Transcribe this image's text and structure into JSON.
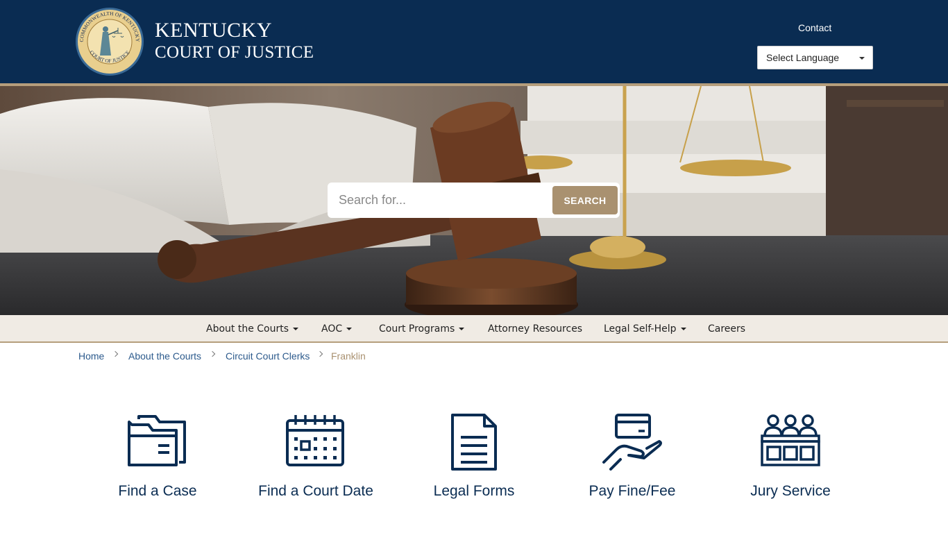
{
  "header": {
    "seal_text_top": "COMMONWEALTH OF KENTUCKY",
    "seal_text_bottom": "COURT OF JUSTICE",
    "brand_line1": "KENTUCKY",
    "brand_line2": "COURT OF JUSTICE",
    "contact_label": "Contact",
    "language_select": "Select Language"
  },
  "search": {
    "placeholder": "Search for...",
    "button_label": "SEARCH"
  },
  "nav": {
    "items": [
      {
        "label": "About the Courts",
        "dropdown": true
      },
      {
        "label": "AOC",
        "dropdown": true
      },
      {
        "label": "Court Programs",
        "dropdown": true
      },
      {
        "label": "Attorney Resources",
        "dropdown": false
      },
      {
        "label": "Legal Self-Help",
        "dropdown": true
      },
      {
        "label": "Careers",
        "dropdown": false
      }
    ]
  },
  "breadcrumb": [
    "Home",
    "About the Courts",
    "Circuit Court Clerks",
    "Franklin"
  ],
  "quick_links": [
    {
      "label": "Find a Case",
      "icon": "folder-icon"
    },
    {
      "label": "Find a Court Date",
      "icon": "calendar-icon"
    },
    {
      "label": "Legal Forms",
      "icon": "document-icon"
    },
    {
      "label": "Pay Fine/Fee",
      "icon": "card-hand-icon"
    },
    {
      "label": "Jury Service",
      "icon": "jury-box-icon"
    }
  ],
  "colors": {
    "navy": "#0a2c52",
    "gold": "#b59e7c",
    "search_button": "#a99170",
    "nav_bg": "#f0ebe4",
    "link": "#2c5a8c"
  }
}
